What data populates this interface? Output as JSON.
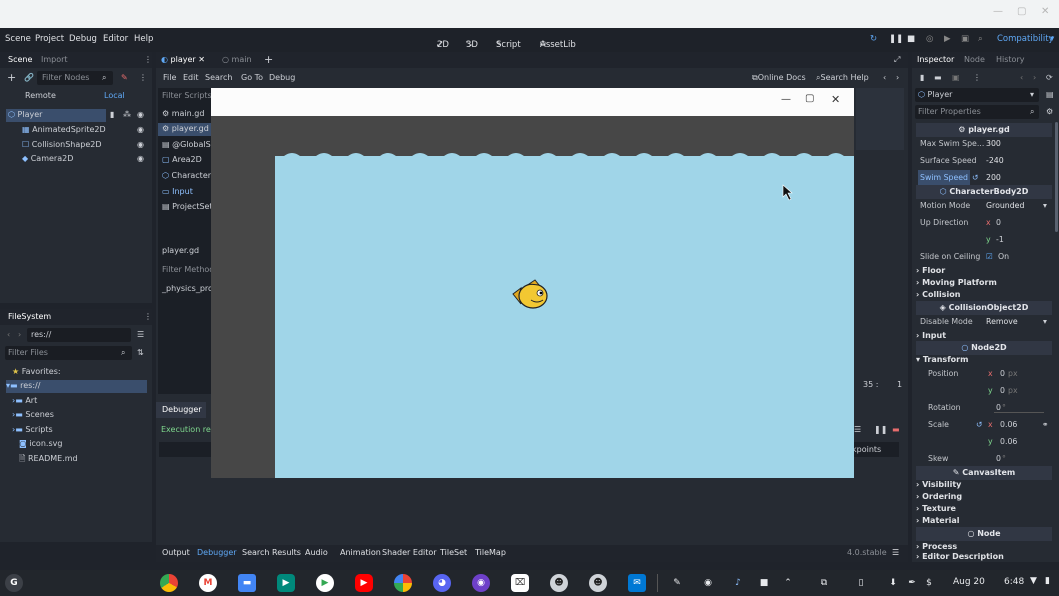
{
  "menu": {
    "items": [
      "Scene",
      "Project",
      "Debug",
      "Editor",
      "Help"
    ],
    "modes": [
      "2D",
      "3D",
      "Script",
      "AssetLib"
    ],
    "renderer": "Compatibility"
  },
  "scene_dock": {
    "tabs": [
      "Scene",
      "Import"
    ],
    "filter_placeholder": "Filter Nodes",
    "remote_label": "Remote",
    "local_label": "Local",
    "nodes": [
      "Player",
      "AnimatedSprite2D",
      "CollisionShape2D",
      "Camera2D"
    ]
  },
  "filesystem": {
    "title": "FileSystem",
    "path": "res://",
    "filter_placeholder": "Filter Files",
    "items": [
      "Favorites:",
      "res://",
      "Art",
      "Scenes",
      "Scripts",
      "icon.svg",
      "README.md"
    ]
  },
  "editor": {
    "tabs": [
      "player",
      "main"
    ],
    "menus": [
      "File",
      "Edit",
      "Search",
      "Go To",
      "Debug"
    ],
    "online_docs": "Online Docs",
    "search_help": "Search Help",
    "filter_scripts": "Filter Scripts",
    "scripts": [
      "main.gd",
      "player.gd",
      "@GlobalSc",
      "Area2D",
      "CharacterB",
      "Input",
      "ProjectSet"
    ],
    "current_script": "player.gd",
    "filter_methods": "Filter Method",
    "methods": [
      "_physics_proc"
    ],
    "line_col": "35 :",
    "col": "1"
  },
  "debugger": {
    "tab": "Debugger",
    "status": "Execution resu",
    "breakpoints": "kpoints"
  },
  "bottom_tabs": [
    "Output",
    "Debugger",
    "Search Results",
    "Audio",
    "Animation",
    "Shader Editor",
    "TileSet",
    "TileMap"
  ],
  "version": "4.0.stable",
  "inspector": {
    "tabs": [
      "Inspector",
      "Node",
      "History"
    ],
    "object": "Player",
    "filter_placeholder": "Filter Properties",
    "script_header": "player.gd",
    "props": [
      {
        "label": "Max Swim Spe...",
        "value": "300"
      },
      {
        "label": "Surface Speed",
        "value": "-240"
      },
      {
        "label": "Swim Speed",
        "value": "200"
      }
    ],
    "char_header": "CharacterBody2D",
    "motion_mode_label": "Motion Mode",
    "motion_mode": "Grounded",
    "up_direction_label": "Up Direction",
    "up_x_axis": "x",
    "up_x": "0",
    "up_y_axis": "y",
    "up_y": "-1",
    "slide_label": "Slide on Ceiling",
    "slide_value": "On",
    "sections1": [
      "Floor",
      "Moving Platform",
      "Collision"
    ],
    "collision_header": "CollisionObject2D",
    "disable_mode_label": "Disable Mode",
    "disable_mode": "Remove",
    "input_section": "Input",
    "node2d_header": "Node2D",
    "transform_section": "Transform",
    "position_label": "Position",
    "pos_x": "0",
    "pos_y": "0",
    "px_unit": "px",
    "rotation_label": "Rotation",
    "rotation": "0",
    "degree": "°",
    "scale_label": "Scale",
    "scale_x": "0.06",
    "scale_y": "0.06",
    "skew_label": "Skew",
    "skew": "0",
    "canvas_header": "CanvasItem",
    "sections2": [
      "Visibility",
      "Ordering",
      "Texture",
      "Material"
    ],
    "node_header": "Node",
    "sections3": [
      "Process",
      "Editor Description"
    ]
  },
  "taskbar": {
    "date": "Aug 20",
    "time": "6:48"
  },
  "colors": {
    "accent": "#5fa8f5",
    "water": "#a0d5e8",
    "fish": "#f2c832"
  }
}
